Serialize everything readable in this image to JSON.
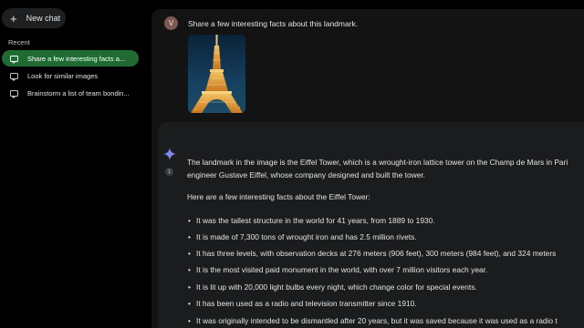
{
  "sidebar": {
    "new_chat_label": "New chat",
    "recent_label": "Recent",
    "history": [
      {
        "label": "Share a few interesting facts a..."
      },
      {
        "label": "Look for similar images"
      },
      {
        "label": "Brainstorm a list of team bondin..."
      }
    ]
  },
  "conversation": {
    "user_avatar_initial": "V",
    "user_prompt": "Share a few interesting facts about this landmark.",
    "source_count": "1",
    "answer_intro_line1": "The landmark in the image is the Eiffel Tower, which is a wrought-iron lattice tower on the Champ de Mars in Pari",
    "answer_intro_line2": "engineer Gustave Eiffel, whose company designed and built the tower.",
    "facts_intro": "Here are a few interesting facts about the Eiffel Tower:",
    "facts": [
      "It was the tallest structure in the world for 41 years, from 1889 to 1930.",
      "It is made of 7,300 tons of wrought iron and has 2.5 million rivets.",
      "It has three levels, with observation decks at 276 meters (906 feet), 300 meters (984 feet), and 324 meters",
      "It is the most visited paid monument in the world, with over 7 million visitors each year.",
      "It is lit up with 20,000 light bulbs every night, which change color for special events.",
      "It has been used as a radio and television transmitter since 1910.",
      "It was originally intended to be dismantled after 20 years, but it was saved because it was used as a radio t"
    ]
  },
  "colors": {
    "active_history_bg": "#1f6b33",
    "main_bg": "#131314",
    "answer_bg": "#1b1c1d"
  },
  "icons": {
    "new_chat": "plus-icon",
    "history": "chat-bubble-icon",
    "assistant": "sparkle-icon"
  }
}
